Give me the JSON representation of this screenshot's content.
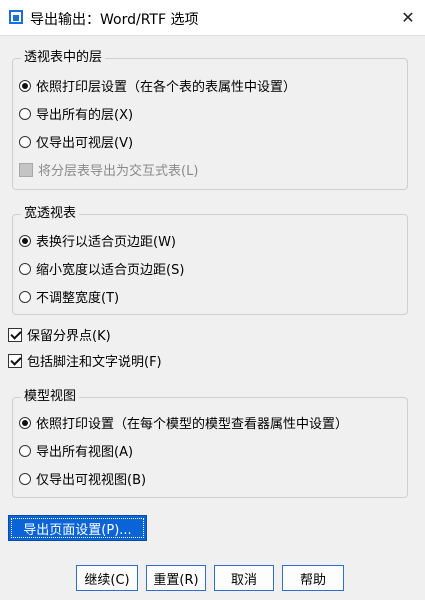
{
  "window": {
    "title": "导出输出：Word/RTF 选项",
    "close_glyph": "✕"
  },
  "pivot_layers": {
    "title": "透视表中的层",
    "options": [
      {
        "label": "依照打印层设置（在各个表的表属性中设置）",
        "selected": true
      },
      {
        "label": "导出所有的层(X)",
        "selected": false
      },
      {
        "label": "仅导出可视层(V)",
        "selected": false
      }
    ],
    "export_as_interactive": {
      "label": "将分层表导出为交互式表(L)",
      "checked": false,
      "enabled": false
    }
  },
  "wide_pivot": {
    "title": "宽透视表",
    "options": [
      {
        "label": "表换行以适合页边距(W)",
        "selected": true
      },
      {
        "label": "缩小宽度以适合页边距(S)",
        "selected": false
      },
      {
        "label": "不调整宽度(T)",
        "selected": false
      }
    ]
  },
  "checkboxes": [
    {
      "label": "保留分界点(K)",
      "checked": true
    },
    {
      "label": "包括脚注和文字说明(F)",
      "checked": true
    }
  ],
  "model_views": {
    "title": "模型视图",
    "options": [
      {
        "label": "依照打印设置（在每个模型的模型查看器属性中设置）",
        "selected": true
      },
      {
        "label": "导出所有视图(A)",
        "selected": false
      },
      {
        "label": "仅导出可视视图(B)",
        "selected": false
      }
    ]
  },
  "page_setup_label": "导出页面设置(P)...",
  "buttons": {
    "continue": "继续(C)",
    "reset": "重置(R)",
    "cancel": "取消",
    "help": "帮助"
  }
}
